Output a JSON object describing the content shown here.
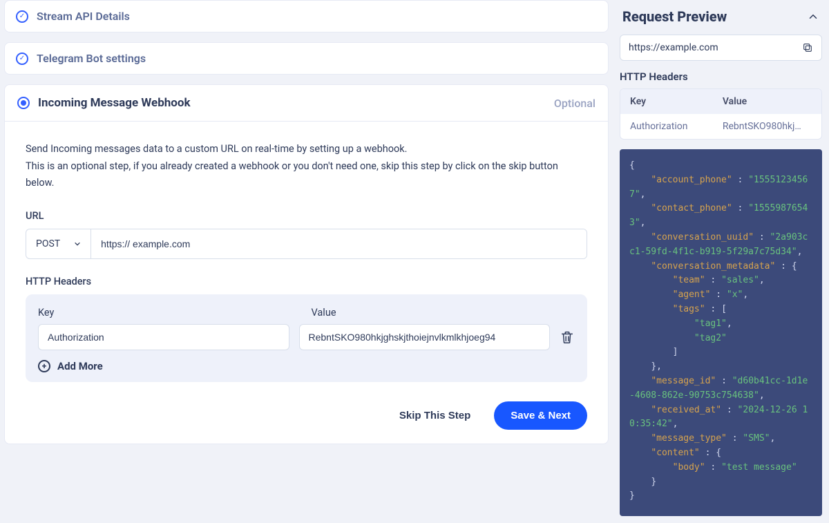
{
  "sections": {
    "stream_api": "Stream API Details",
    "telegram_bot": "Telegram Bot settings"
  },
  "webhook": {
    "title": "Incoming Message Webhook",
    "optional_tag": "Optional",
    "desc_line1": "Send Incoming messages data to a custom URL on real-time by setting up a webhook.",
    "desc_line2": "This is an optional step, if you already created a webhook or you don't need one, skip this step by click on the skip button below.",
    "url_label": "URL",
    "method": "POST",
    "url_value": "https:// example.com",
    "headers_label": "HTTP Headers",
    "key_label": "Key",
    "value_label": "Value",
    "header_key": "Authorization",
    "header_value": "RebntSKO980hkjghskjthoiejnvlkmlkhjoeg94",
    "add_more": "Add More",
    "skip_btn": "Skip This Step",
    "save_btn": "Save & Next"
  },
  "preview": {
    "title": "Request Preview",
    "url": "https://example.com",
    "headers_label": "HTTP Headers",
    "th_key": "Key",
    "th_value": "Value",
    "row_key": "Authorization",
    "row_value": "RebntSKO980hkj…",
    "json": {
      "account_phone": "15551234567",
      "contact_phone": "15559876543",
      "conversation_uuid": "2a903cc1-59fd-4f1c-b919-5f29a7c75d34",
      "conversation_metadata": {
        "team": "sales",
        "agent": "x",
        "tags": [
          "tag1",
          "tag2"
        ]
      },
      "message_id": "d60b41cc-1d1e-4608-862e-90753c754638",
      "received_at": "2024-12-26 10:35:42",
      "message_type": "SMS",
      "content": {
        "body": "test message"
      }
    }
  }
}
